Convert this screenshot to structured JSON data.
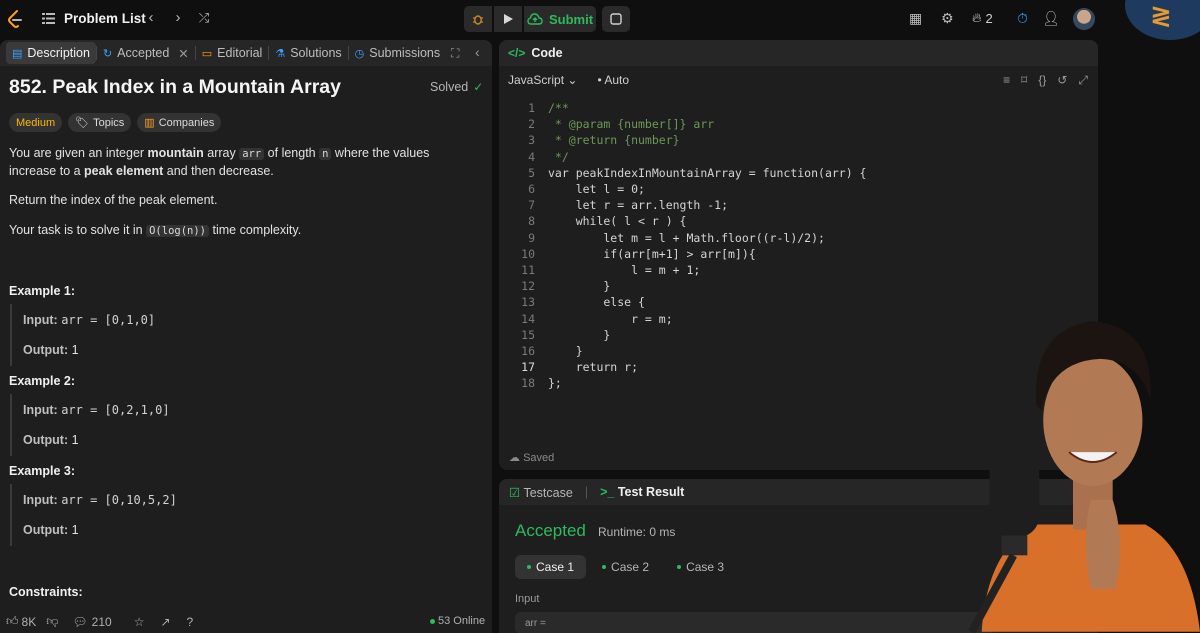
{
  "topbar": {
    "problem_list": "Problem List",
    "submit_label": "Submit",
    "streak_count": "2",
    "colors": {
      "submit": "#2cbb5d",
      "bg": "#0f0f0f"
    }
  },
  "left_panel": {
    "tabs": [
      {
        "label": "Description",
        "icon": "description-icon"
      },
      {
        "label": "Accepted",
        "icon": "history-icon"
      },
      {
        "label": "Editorial",
        "icon": "book-icon"
      },
      {
        "label": "Solutions",
        "icon": "flask-icon"
      },
      {
        "label": "Submissions",
        "icon": "clock-icon"
      }
    ],
    "title": "852. Peak Index in a Mountain Array",
    "solved_label": "Solved",
    "pills": {
      "difficulty": "Medium",
      "topics": "Topics",
      "companies": "Companies"
    },
    "description": {
      "p1_a": "You are given an integer ",
      "p1_b": "mountain",
      "p1_c": " array ",
      "p1_arr": "arr",
      "p1_d": " of length ",
      "p1_n": "n",
      "p1_e": " where the values increase to a ",
      "p1_f": "peak element",
      "p1_g": " and then decrease.",
      "p2": "Return the index of the peak element.",
      "p3_a": "Your task is to solve it in ",
      "p3_code": "O(log(n))",
      "p3_b": " time complexity."
    },
    "examples": [
      {
        "heading": "Example 1:",
        "input_label": "Input:",
        "input": "arr = [0,1,0]",
        "output_label": "Output:",
        "output": "1"
      },
      {
        "heading": "Example 2:",
        "input_label": "Input:",
        "input": "arr = [0,2,1,0]",
        "output_label": "Output:",
        "output": "1"
      },
      {
        "heading": "Example 3:",
        "input_label": "Input:",
        "input": "arr = [0,10,5,2]",
        "output_label": "Output:",
        "output": "1"
      }
    ],
    "constraints_heading": "Constraints:",
    "footer": {
      "likes": "8K",
      "comments": "210",
      "online": "53 Online"
    }
  },
  "code_panel": {
    "header": "Code",
    "language": "JavaScript",
    "mode": "Auto",
    "saved": "Saved",
    "lines": [
      {
        "n": "1",
        "text": "/**",
        "cls": "comment"
      },
      {
        "n": "2",
        "text": " * @param {number[]} arr",
        "cls": "comment"
      },
      {
        "n": "3",
        "text": " * @return {number}",
        "cls": "comment"
      },
      {
        "n": "4",
        "text": " */",
        "cls": "comment"
      },
      {
        "n": "5",
        "text": "var peakIndexInMountainArray = function(arr) {",
        "cls": ""
      },
      {
        "n": "6",
        "text": "    let l = 0;",
        "cls": ""
      },
      {
        "n": "7",
        "text": "    let r = arr.length -1;",
        "cls": ""
      },
      {
        "n": "8",
        "text": "    while( l < r ) {",
        "cls": ""
      },
      {
        "n": "9",
        "text": "        let m = l + Math.floor((r-l)/2);",
        "cls": ""
      },
      {
        "n": "10",
        "text": "        if(arr[m+1] > arr[m]){",
        "cls": ""
      },
      {
        "n": "11",
        "text": "            l = m + 1;",
        "cls": ""
      },
      {
        "n": "12",
        "text": "        }",
        "cls": ""
      },
      {
        "n": "13",
        "text": "        else {",
        "cls": ""
      },
      {
        "n": "14",
        "text": "            r = m;",
        "cls": ""
      },
      {
        "n": "15",
        "text": "        }",
        "cls": ""
      },
      {
        "n": "16",
        "text": "    }",
        "cls": ""
      },
      {
        "n": "17",
        "text": "    return r;",
        "cls": ""
      },
      {
        "n": "18",
        "text": "};",
        "cls": ""
      }
    ]
  },
  "test_panel": {
    "tab_testcase": "Testcase",
    "tab_result": "Test Result",
    "status": "Accepted",
    "runtime": "Runtime: 0 ms",
    "cases": [
      "Case 1",
      "Case 2",
      "Case 3"
    ],
    "input_label": "Input",
    "input_value": "arr ="
  }
}
